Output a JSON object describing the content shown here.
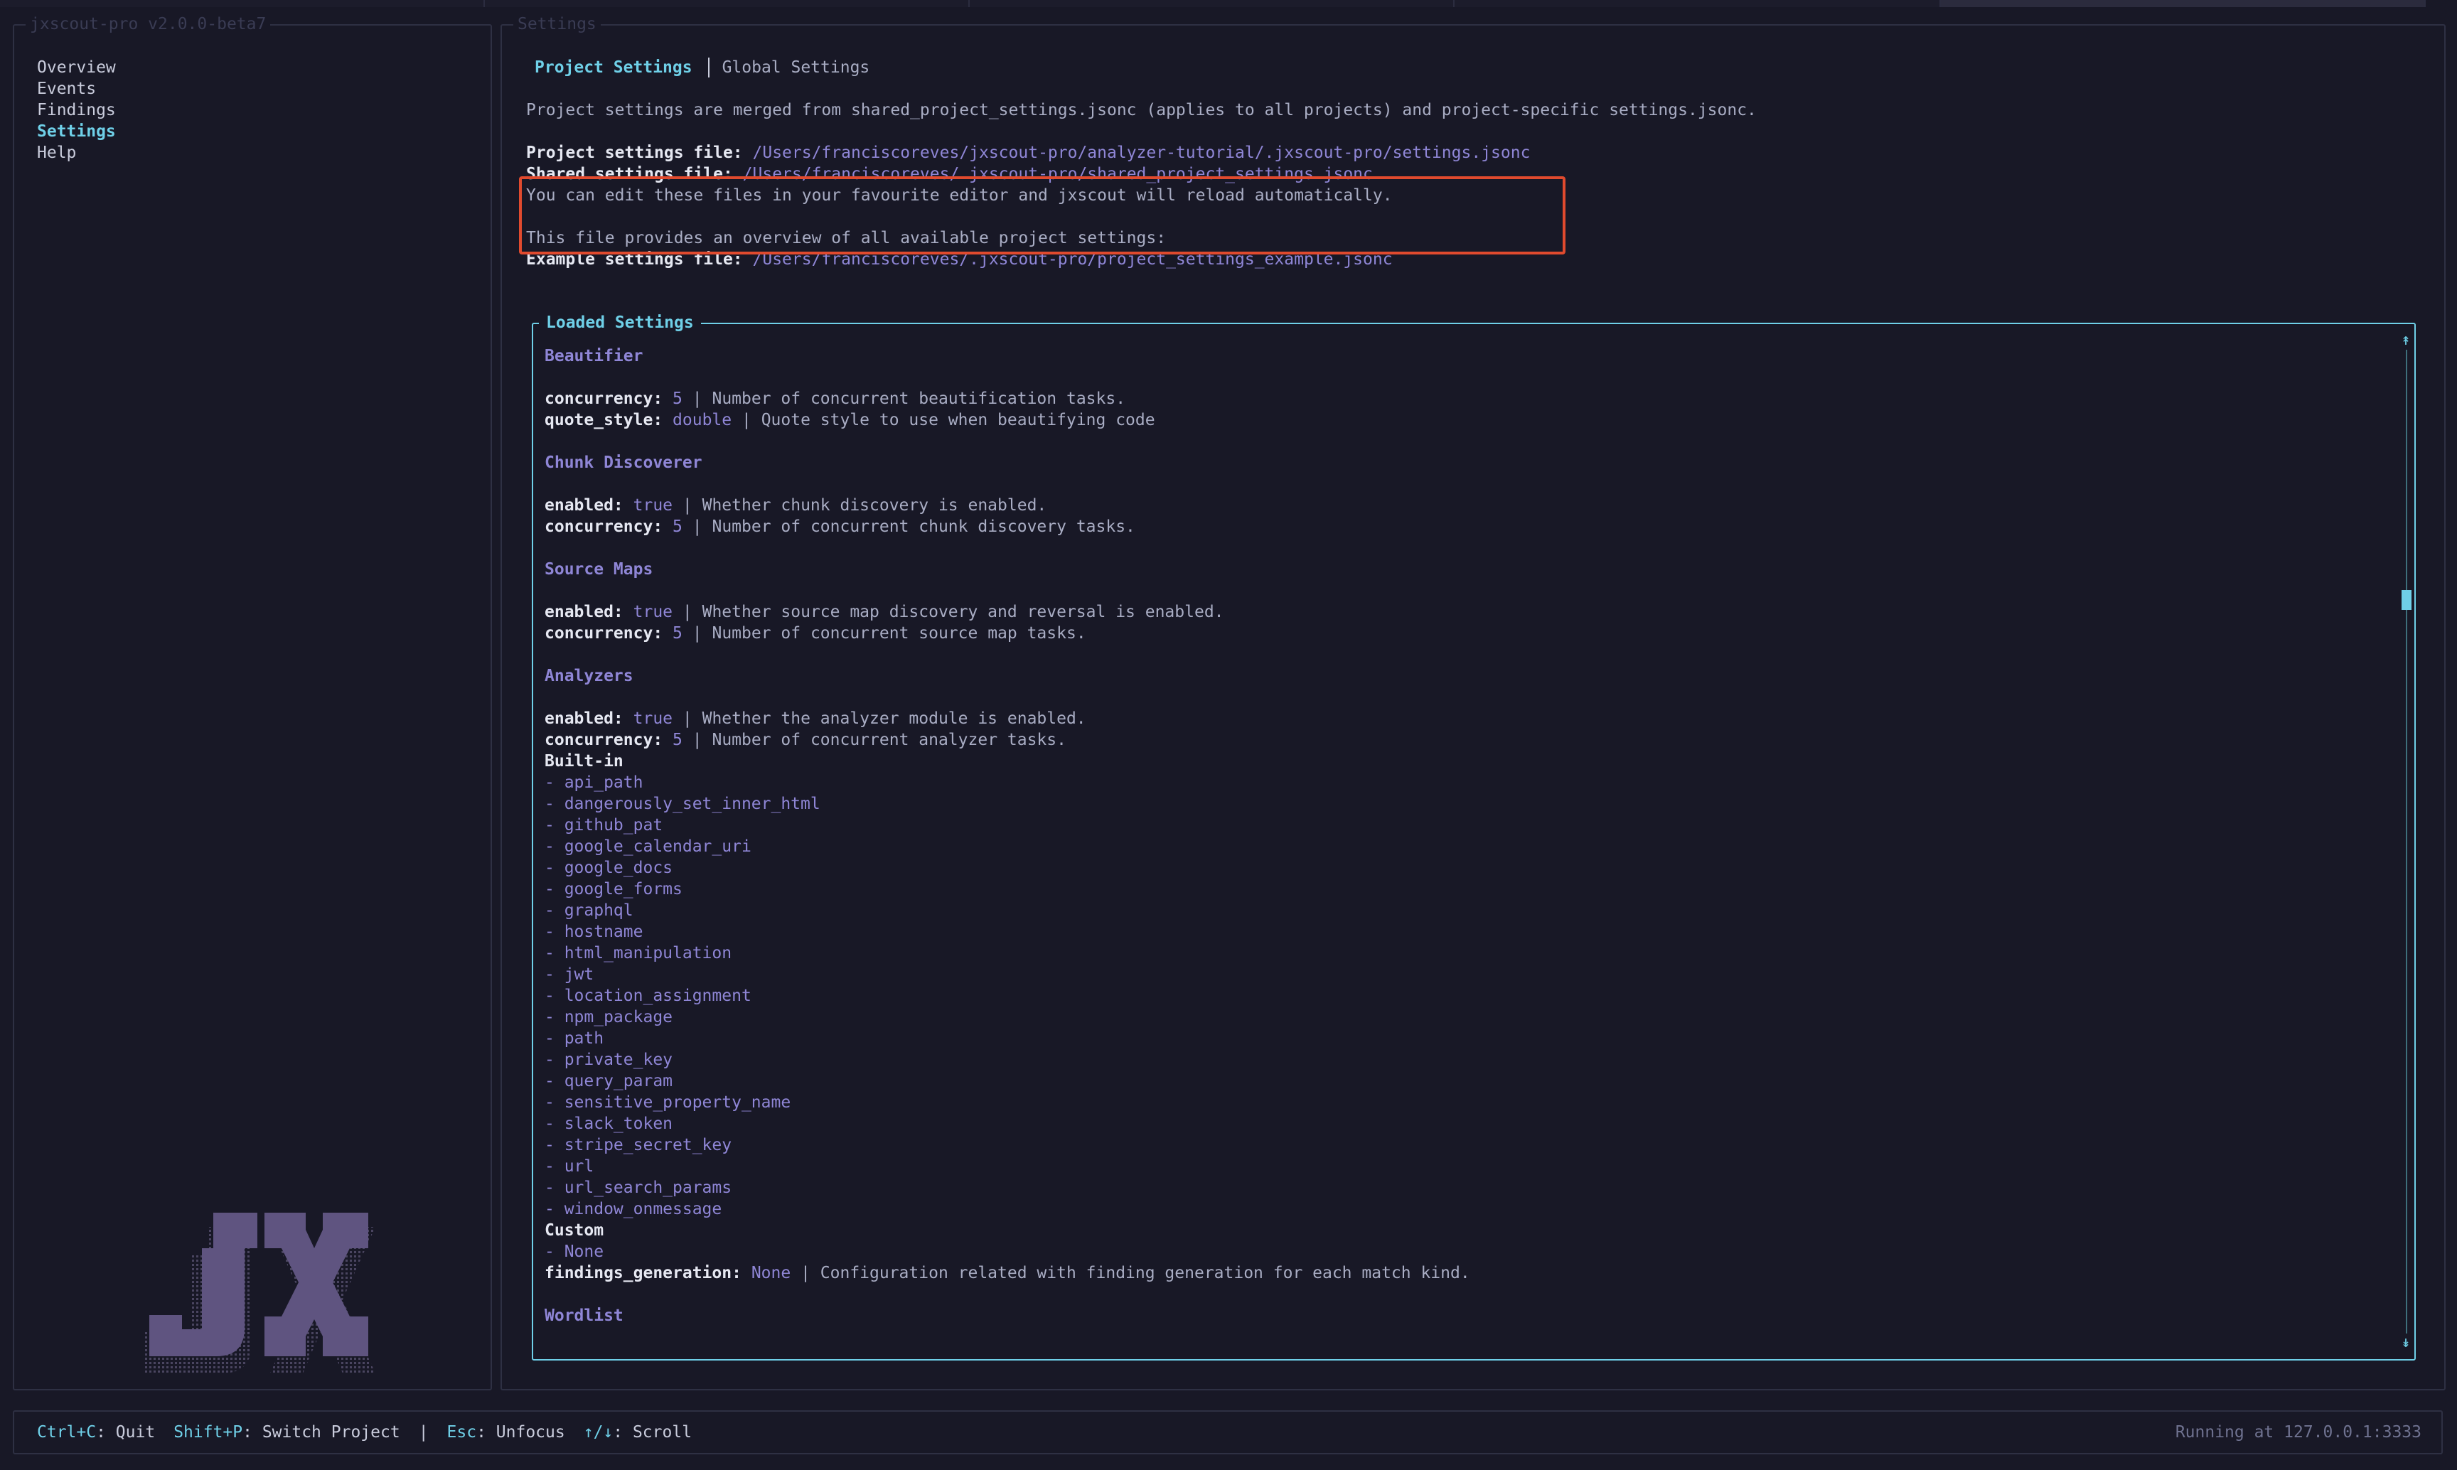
{
  "app": {
    "left_panel_title": "jxscout-pro v2.0.0-beta7",
    "right_panel_title": "Settings",
    "logo_text": "JX"
  },
  "nav": {
    "items": [
      {
        "label": "Overview"
      },
      {
        "label": "Events"
      },
      {
        "label": "Findings"
      },
      {
        "label": "Settings",
        "active": true
      },
      {
        "label": "Help"
      }
    ]
  },
  "settings": {
    "tabs": {
      "project": "Project Settings",
      "global": "Global Settings"
    },
    "intro": "Project settings are merged from shared_project_settings.jsonc (applies to all projects) and project-specific settings.jsonc.",
    "project_file_label": "Project settings file:",
    "project_file_path": "/Users/franciscoreves/jxscout-pro/analyzer-tutorial/.jxscout-pro/settings.jsonc",
    "shared_file_label": "Shared settings file:",
    "shared_file_path": "/Users/franciscoreves/.jxscout-pro/shared_project_settings.jsonc",
    "edit_note": "You can edit these files in your favourite editor and jxscout will reload automatically.",
    "overview_note": "This file provides an overview of all available project settings:",
    "example_file_label": "Example settings file:",
    "example_file_path": "/Users/franciscoreves/.jxscout-pro/project_settings_example.jsonc"
  },
  "loaded": {
    "title": "Loaded Settings",
    "beautifier": {
      "heading": "Beautifier",
      "concurrency_key": "concurrency:",
      "concurrency_val": "5",
      "concurrency_desc": "Number of concurrent beautification tasks.",
      "quote_key": "quote_style:",
      "quote_val": "double",
      "quote_desc": "Quote style to use when beautifying code"
    },
    "chunk": {
      "heading": "Chunk Discoverer",
      "enabled_key": "enabled:",
      "enabled_val": "true",
      "enabled_desc": "Whether chunk discovery is enabled.",
      "concurrency_key": "concurrency:",
      "concurrency_val": "5",
      "concurrency_desc": "Number of concurrent chunk discovery tasks."
    },
    "sourcemaps": {
      "heading": "Source Maps",
      "enabled_key": "enabled:",
      "enabled_val": "true",
      "enabled_desc": "Whether source map discovery and reversal is enabled.",
      "concurrency_key": "concurrency:",
      "concurrency_val": "5",
      "concurrency_desc": "Number of concurrent source map tasks."
    },
    "analyzers": {
      "heading": "Analyzers",
      "enabled_key": "enabled:",
      "enabled_val": "true",
      "enabled_desc": "Whether the analyzer module is enabled.",
      "concurrency_key": "concurrency:",
      "concurrency_val": "5",
      "concurrency_desc": "Number of concurrent analyzer tasks.",
      "builtin_label": "Built-in",
      "builtin": [
        "- api_path",
        "- dangerously_set_inner_html",
        "- github_pat",
        "- google_calendar_uri",
        "- google_docs",
        "- google_forms",
        "- graphql",
        "- hostname",
        "- html_manipulation",
        "- jwt",
        "- location_assignment",
        "- npm_package",
        "- path",
        "- private_key",
        "- query_param",
        "- sensitive_property_name",
        "- slack_token",
        "- stripe_secret_key",
        "- url",
        "- url_search_params",
        "- window_onmessage"
      ],
      "custom_label": "Custom",
      "custom": [
        "- None"
      ],
      "findings_key": "findings_generation:",
      "findings_val": "None",
      "findings_desc": "Configuration related with finding generation for each match kind."
    },
    "wordlist": {
      "heading": "Wordlist"
    },
    "separator": "|"
  },
  "footer": {
    "hints": [
      {
        "key": "Ctrl+C",
        "label": ": Quit"
      },
      {
        "key": "Shift+P",
        "label": ": Switch Project"
      },
      {
        "key": "Esc",
        "label": ": Unfocus"
      },
      {
        "key": "↑/↓",
        "label": ": Scroll"
      }
    ],
    "pipe": "|",
    "status": "Running at 127.0.0.1:3333"
  },
  "colors": {
    "accent": "#6fd0e8",
    "value": "#8f86d6",
    "highlight_box": "#e04a2e",
    "background": "#181826"
  }
}
